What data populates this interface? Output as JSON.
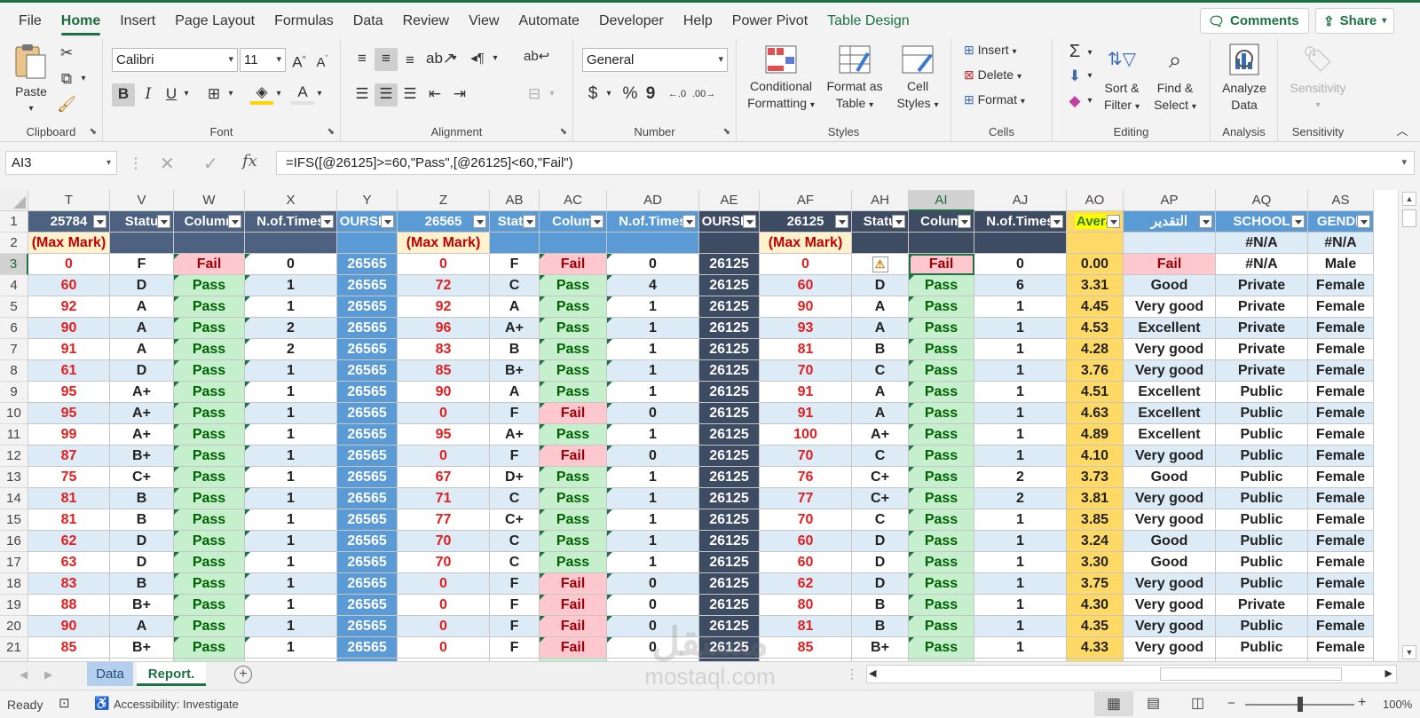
{
  "menu": {
    "tabs": [
      "File",
      "Home",
      "Insert",
      "Page Layout",
      "Formulas",
      "Data",
      "Review",
      "View",
      "Automate",
      "Developer",
      "Help",
      "Power Pivot",
      "Table Design"
    ],
    "active": "Home",
    "comments": "Comments",
    "share": "Share"
  },
  "ribbon": {
    "clipboard": {
      "label": "Clipboard",
      "paste": "Paste"
    },
    "font": {
      "label": "Font",
      "name": "Calibri",
      "size": "11",
      "bold": "B",
      "italic": "I",
      "underline": "U"
    },
    "alignment": {
      "label": "Alignment"
    },
    "number": {
      "label": "Number",
      "format": "General",
      "currency": "$",
      "percent": "%",
      "comma": "9"
    },
    "styles": {
      "label": "Styles",
      "conditional": "Conditional",
      "formatting": "Formatting",
      "format_as": "Format as",
      "table": "Table",
      "cell": "Cell",
      "cell_styles": "Styles"
    },
    "cells": {
      "label": "Cells",
      "insert": "Insert",
      "delete": "Delete",
      "format": "Format"
    },
    "editing": {
      "label": "Editing",
      "sort": "Sort &",
      "filter": "Filter",
      "find": "Find &",
      "select": "Select"
    },
    "analysis": {
      "label": "Analysis",
      "analyze": "Analyze",
      "data": "Data"
    },
    "sensitivity": {
      "label": "Sensitivity",
      "btn": "Sensitivity"
    }
  },
  "formula_bar": {
    "name_box": "AI3",
    "formula": "=IFS([@26125]>=60,\"Pass\",[@26125]<60,\"Fail\")"
  },
  "grid": {
    "columns": [
      "T",
      "V",
      "W",
      "X",
      "Y",
      "Z",
      "AB",
      "AC",
      "AD",
      "AE",
      "AF",
      "AH",
      "AI",
      "AJ",
      "AO",
      "AP",
      "AQ",
      "AS"
    ],
    "selected_column": "AI",
    "row_numbers": [
      "1",
      "2",
      "3",
      "4",
      "5",
      "6",
      "7",
      "8",
      "9",
      "10",
      "11",
      "12",
      "13",
      "14",
      "15",
      "16",
      "17",
      "18",
      "19",
      "20",
      "21",
      "22"
    ],
    "selected_row": "3",
    "header_row": [
      "25784",
      "Statu",
      "Column",
      "N.of.Times",
      "OURSE_",
      "26565",
      "Statu",
      "Colum",
      "N.of.Times",
      "OURSE_",
      "26125",
      "Statu",
      "Colum",
      "N.of.Times",
      "Avera",
      "التقدير",
      "SCHOOL",
      "GENDE"
    ],
    "max_mark_label": "(Max Mark)",
    "row2_na": "#N/A",
    "rows": [
      [
        "0",
        "F",
        "Fail",
        "0",
        "26565",
        "0",
        "F",
        "Fail",
        "0",
        "26125",
        "0",
        "",
        "Fail",
        "0",
        "0.00",
        "Fail",
        "#N/A",
        "Male"
      ],
      [
        "60",
        "D",
        "Pass",
        "1",
        "26565",
        "72",
        "C",
        "Pass",
        "4",
        "26125",
        "60",
        "D",
        "Pass",
        "6",
        "3.31",
        "Good",
        "Private",
        "Female"
      ],
      [
        "92",
        "A",
        "Pass",
        "1",
        "26565",
        "92",
        "A",
        "Pass",
        "1",
        "26125",
        "90",
        "A",
        "Pass",
        "1",
        "4.45",
        "Very good",
        "Private",
        "Female"
      ],
      [
        "90",
        "A",
        "Pass",
        "2",
        "26565",
        "96",
        "A+",
        "Pass",
        "1",
        "26125",
        "93",
        "A",
        "Pass",
        "1",
        "4.53",
        "Excellent",
        "Private",
        "Female"
      ],
      [
        "91",
        "A",
        "Pass",
        "2",
        "26565",
        "83",
        "B",
        "Pass",
        "1",
        "26125",
        "81",
        "B",
        "Pass",
        "1",
        "4.28",
        "Very good",
        "Private",
        "Female"
      ],
      [
        "61",
        "D",
        "Pass",
        "1",
        "26565",
        "85",
        "B+",
        "Pass",
        "1",
        "26125",
        "70",
        "C",
        "Pass",
        "1",
        "3.76",
        "Very good",
        "Private",
        "Female"
      ],
      [
        "95",
        "A+",
        "Pass",
        "1",
        "26565",
        "90",
        "A",
        "Pass",
        "1",
        "26125",
        "91",
        "A",
        "Pass",
        "1",
        "4.51",
        "Excellent",
        "Public",
        "Female"
      ],
      [
        "95",
        "A+",
        "Pass",
        "1",
        "26565",
        "0",
        "F",
        "Fail",
        "0",
        "26125",
        "91",
        "A",
        "Pass",
        "1",
        "4.63",
        "Excellent",
        "Public",
        "Female"
      ],
      [
        "99",
        "A+",
        "Pass",
        "1",
        "26565",
        "95",
        "A+",
        "Pass",
        "1",
        "26125",
        "100",
        "A+",
        "Pass",
        "1",
        "4.89",
        "Excellent",
        "Public",
        "Female"
      ],
      [
        "87",
        "B+",
        "Pass",
        "1",
        "26565",
        "0",
        "F",
        "Fail",
        "0",
        "26125",
        "70",
        "C",
        "Pass",
        "1",
        "4.10",
        "Very good",
        "Public",
        "Female"
      ],
      [
        "75",
        "C+",
        "Pass",
        "1",
        "26565",
        "67",
        "D+",
        "Pass",
        "1",
        "26125",
        "76",
        "C+",
        "Pass",
        "2",
        "3.73",
        "Good",
        "Public",
        "Female"
      ],
      [
        "81",
        "B",
        "Pass",
        "1",
        "26565",
        "71",
        "C",
        "Pass",
        "1",
        "26125",
        "77",
        "C+",
        "Pass",
        "2",
        "3.81",
        "Very good",
        "Public",
        "Female"
      ],
      [
        "81",
        "B",
        "Pass",
        "1",
        "26565",
        "77",
        "C+",
        "Pass",
        "1",
        "26125",
        "70",
        "C",
        "Pass",
        "1",
        "3.85",
        "Very good",
        "Public",
        "Female"
      ],
      [
        "62",
        "D",
        "Pass",
        "1",
        "26565",
        "70",
        "C",
        "Pass",
        "1",
        "26125",
        "60",
        "D",
        "Pass",
        "1",
        "3.24",
        "Good",
        "Public",
        "Female"
      ],
      [
        "63",
        "D",
        "Pass",
        "1",
        "26565",
        "70",
        "C",
        "Pass",
        "1",
        "26125",
        "60",
        "D",
        "Pass",
        "1",
        "3.30",
        "Good",
        "Public",
        "Female"
      ],
      [
        "83",
        "B",
        "Pass",
        "1",
        "26565",
        "0",
        "F",
        "Fail",
        "0",
        "26125",
        "62",
        "D",
        "Pass",
        "1",
        "3.75",
        "Very good",
        "Public",
        "Female"
      ],
      [
        "88",
        "B+",
        "Pass",
        "1",
        "26565",
        "0",
        "F",
        "Fail",
        "0",
        "26125",
        "80",
        "B",
        "Pass",
        "1",
        "4.30",
        "Very good",
        "Private",
        "Female"
      ],
      [
        "90",
        "A",
        "Pass",
        "1",
        "26565",
        "0",
        "F",
        "Fail",
        "0",
        "26125",
        "81",
        "B",
        "Pass",
        "1",
        "4.35",
        "Very good",
        "Public",
        "Female"
      ],
      [
        "85",
        "B+",
        "Pass",
        "1",
        "26565",
        "0",
        "F",
        "Fail",
        "0",
        "26125",
        "85",
        "B+",
        "Pass",
        "1",
        "4.33",
        "Very good",
        "Public",
        "Female"
      ]
    ]
  },
  "sheets": {
    "tabs": [
      "Data",
      "Report."
    ],
    "active": "Report."
  },
  "status": {
    "ready": "Ready",
    "accessibility": "Accessibility: Investigate",
    "zoom": "100%",
    "zoom_fraction": 0.5
  },
  "watermark": {
    "ar": "مستقل",
    "en": "mostaql.com"
  },
  "colors": {
    "accent": "#1e7145",
    "header_slate": "#4d6280",
    "course_blue": "#5b9bd5",
    "course_navy": "#3d4b63",
    "pass_bg": "#c6efce",
    "fail_bg": "#ffc7ce",
    "average_bg": "#ffd966"
  }
}
